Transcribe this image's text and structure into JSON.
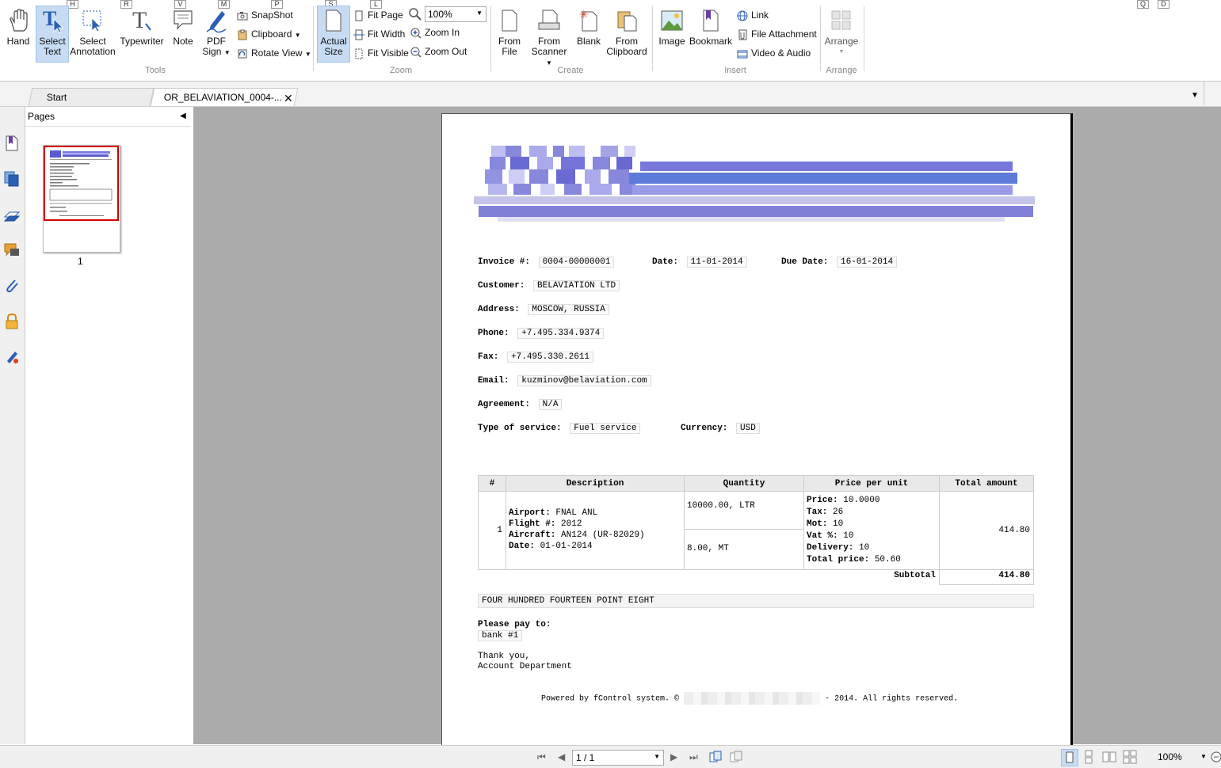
{
  "keytips": [
    "H",
    "R",
    "V",
    "M",
    "P",
    "S",
    "L",
    "Q",
    "D"
  ],
  "ribbon": {
    "tools": {
      "hand": "Hand",
      "select_text_1": "Select",
      "select_text_2": "Text",
      "select_annotation_1": "Select",
      "select_annotation_2": "Annotation",
      "typewriter": "Typewriter",
      "note": "Note",
      "pdf_sign_1": "PDF",
      "pdf_sign_2": "Sign",
      "snapshot": "SnapShot",
      "clipboard": "Clipboard",
      "rotate_view": "Rotate View",
      "group": "Tools"
    },
    "zoom": {
      "actual_size_1": "Actual",
      "actual_size_2": "Size",
      "fit_page": "Fit Page",
      "fit_width": "Fit Width",
      "fit_visible": "Fit Visible",
      "zoom_value": "100%",
      "zoom_in": "Zoom In",
      "zoom_out": "Zoom Out",
      "group": "Zoom"
    },
    "create": {
      "from_file_1": "From",
      "from_file_2": "File",
      "from_scanner_1": "From",
      "from_scanner_2": "Scanner",
      "blank": "Blank",
      "from_clipboard_1": "From",
      "from_clipboard_2": "Clipboard",
      "group": "Create"
    },
    "insert": {
      "image": "Image",
      "bookmark": "Bookmark",
      "link": "Link",
      "file_attachment": "File Attachment",
      "video_audio": "Video & Audio",
      "group": "Insert"
    },
    "arrange": {
      "arrange": "Arrange",
      "group": "Arrange"
    }
  },
  "tabs": [
    {
      "label": "Start"
    },
    {
      "label": "OR_BELAVIATION_0004-..."
    }
  ],
  "pages_panel": {
    "title": "Pages",
    "thumb_number": "1"
  },
  "invoice": {
    "invoice_no_label": "Invoice #:",
    "invoice_no": "0004-00000001",
    "date_label": "Date:",
    "date": "11-01-2014",
    "due_label": "Due Date:",
    "due_date": "16-01-2014",
    "customer_label": "Customer:",
    "customer": "BELAVIATION LTD",
    "address_label": "Address:",
    "address": "MOSCOW, RUSSIA",
    "phone_label": "Phone:",
    "phone": "+7.495.334.9374",
    "fax_label": "Fax:",
    "fax": "+7.495.330.2611",
    "email_label": "Email:",
    "email": "kuzminov@belaviation.com",
    "agreement_label": "Agreement:",
    "agreement": "N/A",
    "service_label": "Type of service:",
    "service": "Fuel service",
    "currency_label": "Currency:",
    "currency": "USD",
    "table": {
      "headers": [
        "#",
        "Description",
        "Quantity",
        "Price per unit",
        "Total amount"
      ],
      "row_no": "1",
      "airport_label": "Airport:",
      "airport": "FNAL ANL",
      "flight_label": "Flight #:",
      "flight": "2012",
      "aircraft_label": "Aircraft:",
      "aircraft": "AN124 (UR-82029)",
      "date_label": "Date:",
      "date": "01-01-2014",
      "qty1": "10000.00, LTR",
      "qty2": "8.00, MT",
      "price_label": "Price:",
      "price": "10.0000",
      "tax_label": "Tax:",
      "tax": "26",
      "mot_label": "Mot:",
      "mot": "10",
      "vat_label": "Vat %:",
      "vat": "10",
      "delivery_label": "Delivery:",
      "delivery": "10",
      "total_price_label": "Total price:",
      "total_price": "50.60",
      "total_amount": "414.80",
      "subtotal_label": "Subtotal",
      "subtotal": "414.80"
    },
    "amount_words": "FOUR HUNDRED FOURTEEN POINT EIGHT",
    "pay_to_label": "Please pay to:",
    "pay_to": "bank #1",
    "thanks_1": "Thank you,",
    "thanks_2": "Account Department",
    "footer_left": "Powered by fControl system. ©",
    "footer_right": "- 2014. All rights reserved."
  },
  "statusbar": {
    "page_value": "1 / 1",
    "zoom": "100%"
  },
  "colors": {
    "accent_blue": "#2b5fb4",
    "active_button": "#c7dcf3",
    "viewer_bg": "#ababab",
    "thumb_border": "#d40000"
  }
}
